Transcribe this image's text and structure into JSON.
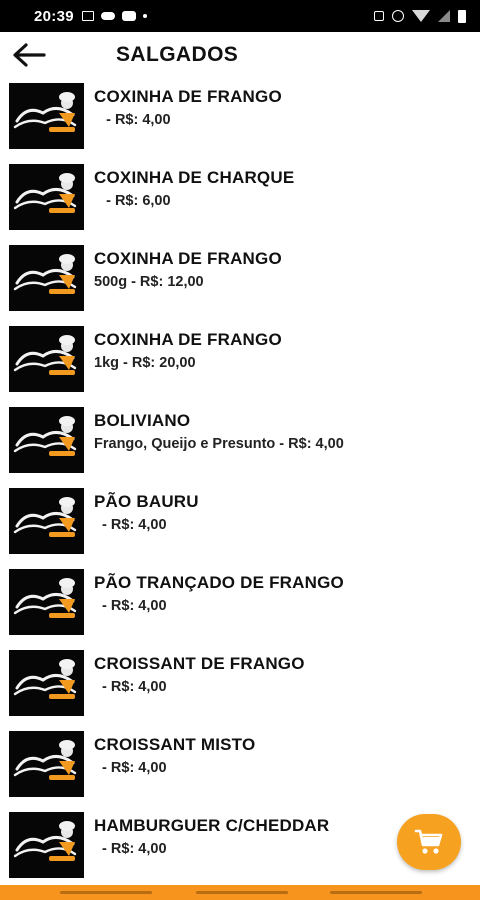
{
  "status_bar": {
    "time": "20:39",
    "left_icons": [
      "image-icon",
      "cloud-icon",
      "youtube-icon",
      "dot-icon"
    ],
    "right_icons": [
      "lock-icon",
      "alarm-icon",
      "wifi-icon",
      "signal-icon",
      "battery-icon"
    ]
  },
  "header": {
    "title": "SALGADOS",
    "back_icon": "arrow-left-icon"
  },
  "products": [
    {
      "name": "COXINHA DE FRANGO",
      "desc": "   - R$: 4,00"
    },
    {
      "name": "COXINHA DE CHARQUE",
      "desc": "   - R$: 6,00"
    },
    {
      "name": "COXINHA DE FRANGO",
      "desc": "500g - R$: 12,00"
    },
    {
      "name": "COXINHA DE FRANGO",
      "desc": "1kg - R$: 20,00"
    },
    {
      "name": "BOLIVIANO",
      "desc": "Frango, Queijo e Presunto - R$: 4,00"
    },
    {
      "name": "PÃO BAURU",
      "desc": "  - R$: 4,00"
    },
    {
      "name": "PÃO TRANÇADO DE FRANGO",
      "desc": "  - R$: 4,00"
    },
    {
      "name": "CROISSANT DE FRANGO",
      "desc": "  - R$: 4,00"
    },
    {
      "name": "CROISSANT MISTO",
      "desc": "  - R$: 4,00"
    },
    {
      "name": "HAMBURGUER C/CHEDDAR",
      "desc": "  - R$: 4,00"
    }
  ],
  "cart_button": {
    "icon": "cart-icon",
    "color": "#f6a11f"
  },
  "colors": {
    "accent": "#f7941d",
    "status_bar": "#000000"
  }
}
